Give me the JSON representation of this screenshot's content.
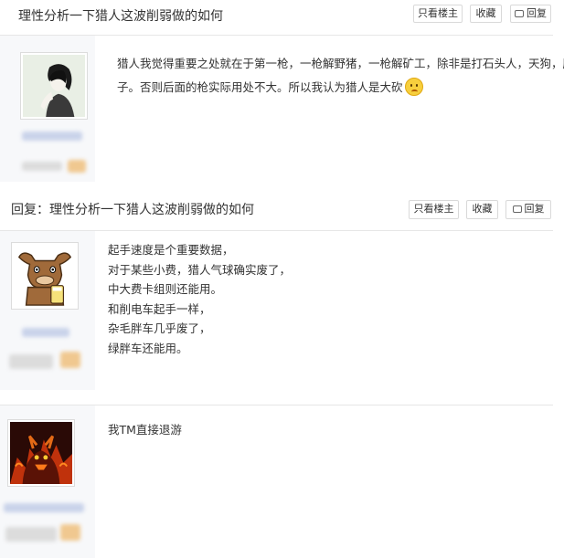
{
  "thread": {
    "title": "理性分析一下猎人这波削弱做的如何",
    "reply_title": "回复：理性分析一下猎人这波削弱做的如何",
    "buttons": {
      "only_op": "只看楼主",
      "favorite": "收藏",
      "reply": "回复"
    }
  },
  "posts": [
    {
      "lines": [
        "猎人我觉得重要之处就在于第一枪，一枪解野猪，一枪解矿工，除非是打石头人，天狗，胖",
        "子。否则后面的枪实际用处不大。所以我认为猎人是大砍"
      ],
      "emoji": "sad-face-emoji"
    },
    {
      "lines": [
        "起手速度是个重要数据，",
        "对于某些小费，猎人气球确实废了，",
        "中大费卡组则还能用。",
        "和削电车起手一样，",
        "杂毛胖车几乎废了，",
        "绿胖车还能用。"
      ]
    },
    {
      "lines": [
        "我TM直接退游"
      ]
    }
  ],
  "colors": {
    "sidebar": "#f7f8fa",
    "border": "#d9d9d9",
    "text": "#333333"
  }
}
